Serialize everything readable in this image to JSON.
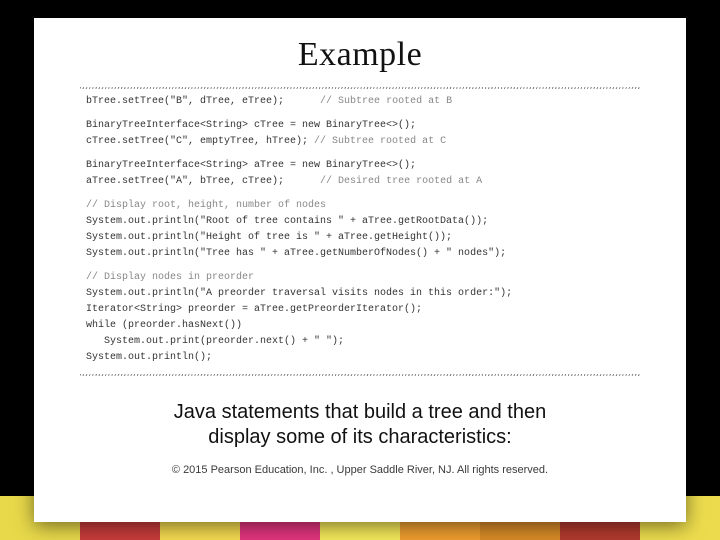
{
  "slide": {
    "title": "Example",
    "code": {
      "l01a": "bTree.setTree(\"B\", dTree, eTree);",
      "l01c": "      // Subtree rooted at B",
      "l02": "BinaryTreeInterface<String> cTree = new BinaryTree<>();",
      "l03a": "cTree.setTree(\"C\", emptyTree, hTree);",
      "l03c": " // Subtree rooted at C",
      "l04": "BinaryTreeInterface<String> aTree = new BinaryTree<>();",
      "l05a": "aTree.setTree(\"A\", bTree, cTree);",
      "l05c": "      // Desired tree rooted at A",
      "l06": "// Display root, height, number of nodes",
      "l07": "System.out.println(\"Root of tree contains \" + aTree.getRootData());",
      "l08": "System.out.println(\"Height of tree is \" + aTree.getHeight());",
      "l09": "System.out.println(\"Tree has \" + aTree.getNumberOfNodes() + \" nodes\");",
      "l10": "// Display nodes in preorder",
      "l11": "System.out.println(\"A preorder traversal visits nodes in this order:\");",
      "l12": "Iterator<String> preorder = aTree.getPreorderIterator();",
      "l13": "while (preorder.hasNext())",
      "l14": "   System.out.print(preorder.next() + \" \");",
      "l15": "System.out.println();"
    },
    "caption_line1": "Java statements that build a tree and then",
    "caption_line2": "display some of its characteristics:",
    "copyright": "© 2015 Pearson Education, Inc. , Upper Saddle River, NJ.  All rights reserved."
  }
}
